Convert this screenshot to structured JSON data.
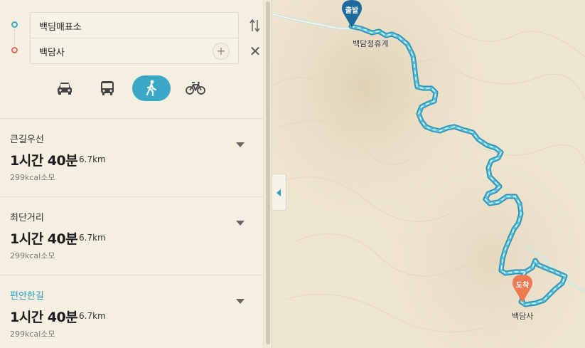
{
  "search": {
    "origin_value": "백딤매표소",
    "destination_value": "백담사",
    "add_stop_symbol": "+",
    "close_symbol": "✕"
  },
  "modes": [
    {
      "name": "car",
      "icon": "car-icon",
      "active": false
    },
    {
      "name": "transit",
      "icon": "bus-icon",
      "active": false
    },
    {
      "name": "walk",
      "icon": "walking-person-icon",
      "active": true
    },
    {
      "name": "bike",
      "icon": "bicycle-icon",
      "active": false
    }
  ],
  "routes": [
    {
      "name": "큰길우선",
      "time": "1시간 40분",
      "distance": "6.7km",
      "kcal": "299kcal소모",
      "highlight": false
    },
    {
      "name": "최단거리",
      "time": "1시간 40분",
      "distance": "6.7km",
      "kcal": "299kcal소모",
      "highlight": false
    },
    {
      "name": "편안한길",
      "time": "1시간 40분",
      "distance": "6.7km",
      "kcal": "299kcal소모",
      "highlight": true
    }
  ],
  "map": {
    "start_pin_text": "출발",
    "start_label": "백담정휴게",
    "end_pin_text": "도착",
    "end_label": "백담사",
    "colors": {
      "route": "#3aa7c6",
      "start_pin": "#1d6b9e",
      "end_pin": "#ef7a52",
      "terrain": "#efe6d2"
    }
  }
}
